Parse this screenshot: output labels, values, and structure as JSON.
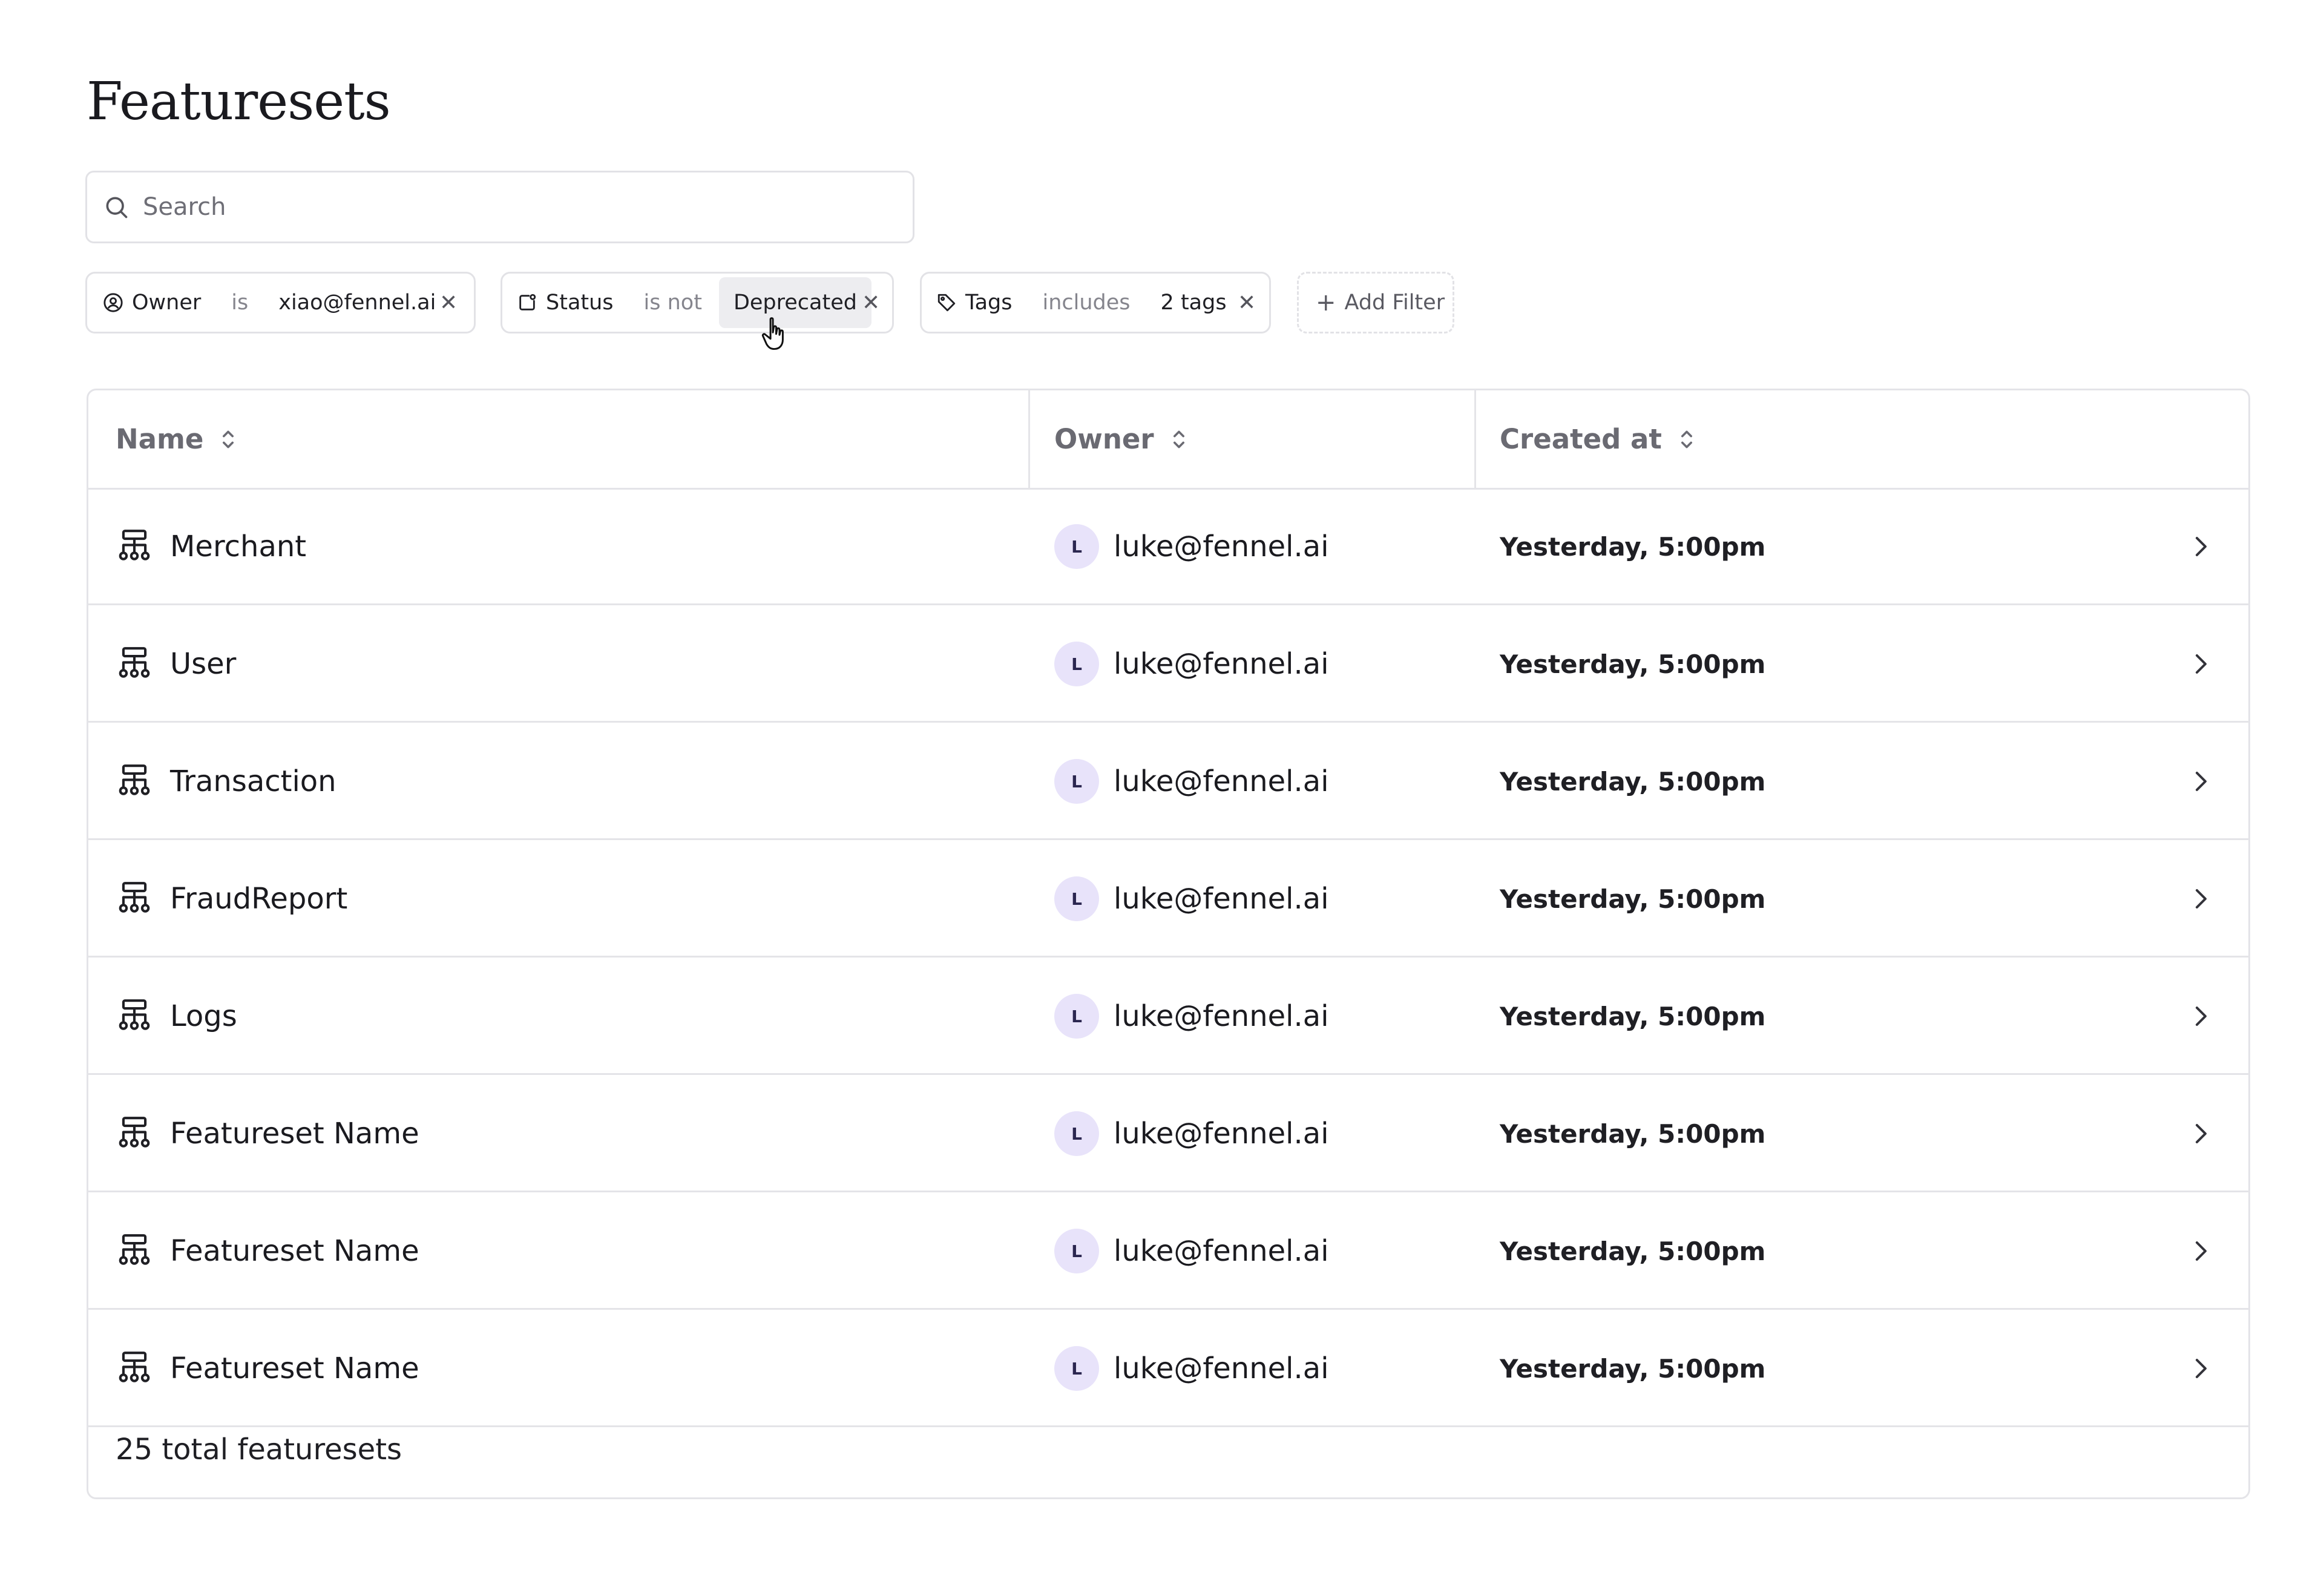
{
  "page": {
    "title": "Featuresets"
  },
  "search": {
    "placeholder": "Search"
  },
  "filters": [
    {
      "field": "Owner",
      "operator": "is",
      "value": "xiao@fennel.ai",
      "icon": "user-circle-icon"
    },
    {
      "field": "Status",
      "operator": "is not",
      "value": "Deprecated",
      "icon": "status-icon"
    },
    {
      "field": "Tags",
      "operator": "includes",
      "value": "2 tags",
      "icon": "tag-icon"
    }
  ],
  "add_filter": {
    "label": "Add Filter"
  },
  "table": {
    "columns": [
      "Name",
      "Owner",
      "Created at"
    ],
    "rows": [
      {
        "name": "Merchant",
        "owner_initial": "L",
        "owner": "luke@fennel.ai",
        "created": "Yesterday, 5:00pm"
      },
      {
        "name": "User",
        "owner_initial": "L",
        "owner": "luke@fennel.ai",
        "created": "Yesterday, 5:00pm"
      },
      {
        "name": "Transaction",
        "owner_initial": "L",
        "owner": "luke@fennel.ai",
        "created": "Yesterday, 5:00pm"
      },
      {
        "name": "FraudReport",
        "owner_initial": "L",
        "owner": "luke@fennel.ai",
        "created": "Yesterday, 5:00pm"
      },
      {
        "name": "Logs",
        "owner_initial": "L",
        "owner": "luke@fennel.ai",
        "created": "Yesterday, 5:00pm"
      },
      {
        "name": "Featureset Name",
        "owner_initial": "L",
        "owner": "luke@fennel.ai",
        "created": "Yesterday, 5:00pm"
      },
      {
        "name": "Featureset Name",
        "owner_initial": "L",
        "owner": "luke@fennel.ai",
        "created": "Yesterday, 5:00pm"
      },
      {
        "name": "Featureset Name",
        "owner_initial": "L",
        "owner": "luke@fennel.ai",
        "created": "Yesterday, 5:00pm"
      }
    ],
    "footer": "25 total featuresets"
  },
  "colors": {
    "avatar_bg": "#e8e3fa",
    "border": "#e4e4e8",
    "muted_text": "#6a6a72"
  }
}
